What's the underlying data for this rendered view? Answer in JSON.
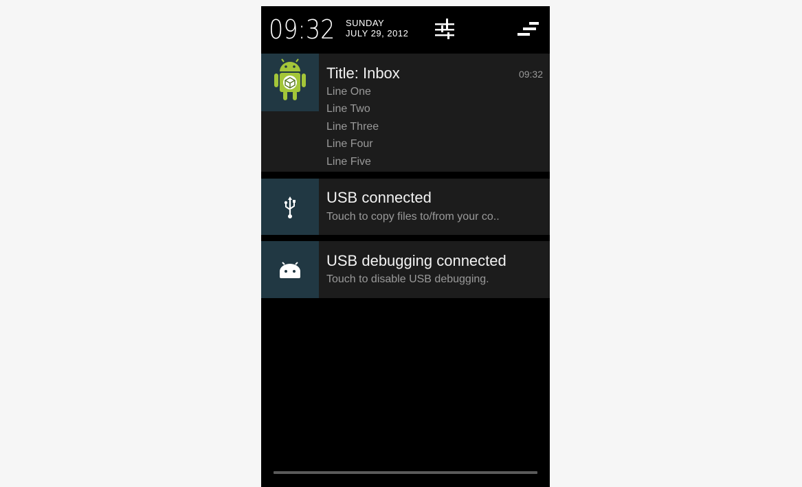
{
  "status_header": {
    "time": "09:32",
    "day": "SUNDAY",
    "date": "JULY 29, 2012",
    "settings_icon": "settings-sliders-icon",
    "clear_icon": "clear-all-icon"
  },
  "notifications": [
    {
      "icon": "android-app-icon",
      "title": "Title: Inbox",
      "time": "09:32",
      "lines": [
        "Line One",
        "Line Two",
        "Line Three",
        "Line Four",
        "Line Five"
      ]
    },
    {
      "icon": "usb-icon",
      "title": "USB connected",
      "text": "Touch to copy files to/from your co.."
    },
    {
      "icon": "android-debug-icon",
      "title": "USB debugging connected",
      "text": "Touch to disable USB debugging."
    }
  ],
  "colors": {
    "background": "#f6f6f6",
    "panel": "#000000",
    "notification_bg": "#1c1c1c",
    "icon_box": "#213843",
    "android_green": "#a4c639"
  }
}
